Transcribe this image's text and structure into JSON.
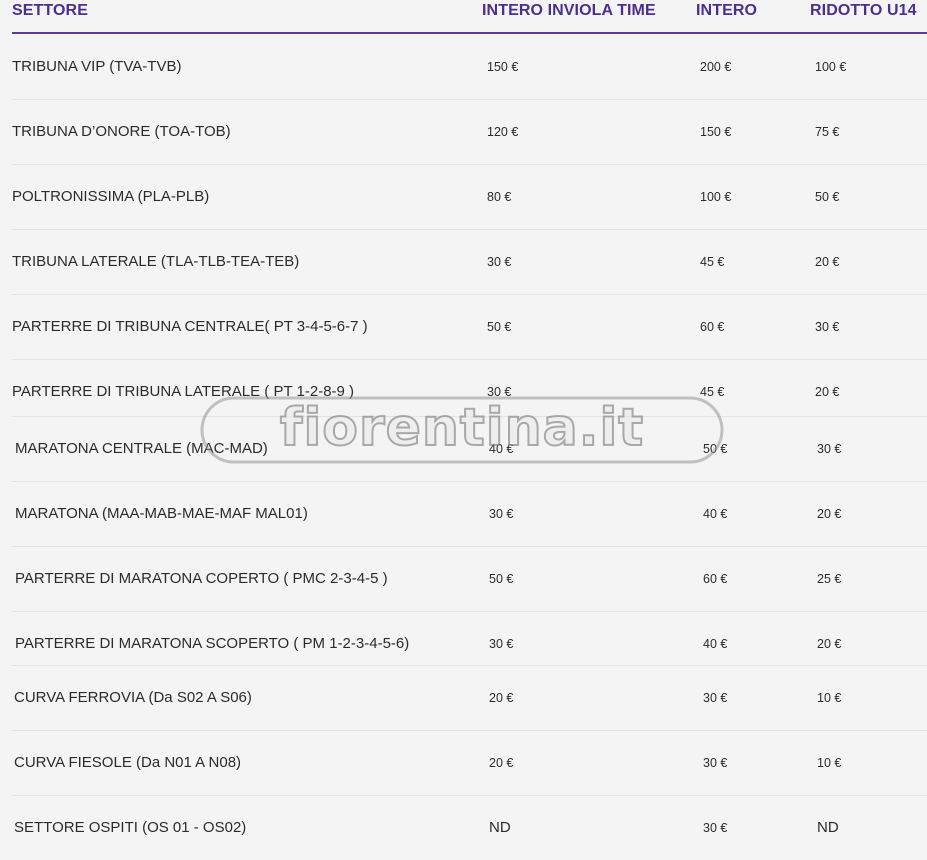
{
  "table": {
    "headers": {
      "sector": "SETTORE",
      "intero_inviola": "INTERO INVIOLA TIME",
      "intero": "INTERO",
      "ridotto": "RIDOTTO U14"
    },
    "rows": [
      {
        "sector": "TRIBUNA VIP (TVA-TVB)",
        "intero_inviola": "150 €",
        "intero": "200 €",
        "ridotto": "100 €"
      },
      {
        "sector": "TRIBUNA D’ONORE (TOA-TOB)",
        "intero_inviola": "120 €",
        "intero": "150 €",
        "ridotto": "75 €"
      },
      {
        "sector": "POLTRONISSIMA (PLA-PLB)",
        "intero_inviola": "80 €",
        "intero": "100 €",
        "ridotto": "50 €"
      },
      {
        "sector": "TRIBUNA LATERALE (TLA-TLB-TEA-TEB)",
        "intero_inviola": "30 €",
        "intero": "45 €",
        "ridotto": "20 €"
      },
      {
        "sector": "PARTERRE DI TRIBUNA CENTRALE( PT 3-4-5-6-7 )",
        "intero_inviola": "50 €",
        "intero": "60 €",
        "ridotto": "30 €"
      },
      {
        "sector": "PARTERRE DI TRIBUNA LATERALE ( PT 1-2-8-9 )",
        "intero_inviola": "30 €",
        "intero": "45 €",
        "ridotto": "20 €"
      },
      {
        "sector": "MARATONA CENTRALE (MAC-MAD)",
        "intero_inviola": "40 €",
        "intero": "50 €",
        "ridotto": "30 €"
      },
      {
        "sector": "MARATONA (MAA-MAB-MAE-MAF MAL01)",
        "intero_inviola": "30 €",
        "intero": "40 €",
        "ridotto": "20 €"
      },
      {
        "sector": "PARTERRE DI MARATONA COPERTO ( PMC 2-3-4-5 )",
        "intero_inviola": "50 €",
        "intero": "60 €",
        "ridotto": "25 €"
      },
      {
        "sector": "PARTERRE DI MARATONA SCOPERTO ( PM 1-2-3-4-5-6)",
        "intero_inviola": "30 €",
        "intero": "40 €",
        "ridotto": "20 €"
      },
      {
        "sector": "CURVA FERROVIA (Da S02 A S06)",
        "intero_inviola": "20 €",
        "intero": "30 €",
        "ridotto": "10 €"
      },
      {
        "sector": "CURVA FIESOLE (Da N01 A N08)",
        "intero_inviola": "20 €",
        "intero": "30 €",
        "ridotto": "10 €"
      },
      {
        "sector": "SETTORE OSPITI (OS 01 - OS02)",
        "intero_inviola": "ND",
        "intero": "30 €",
        "ridotto": "ND"
      }
    ]
  },
  "watermark": {
    "text": "fiorentina.it"
  },
  "colors": {
    "header_text": "#4b2f8e",
    "header_rule": "#5b3a95",
    "background": "#f4f4f4"
  }
}
